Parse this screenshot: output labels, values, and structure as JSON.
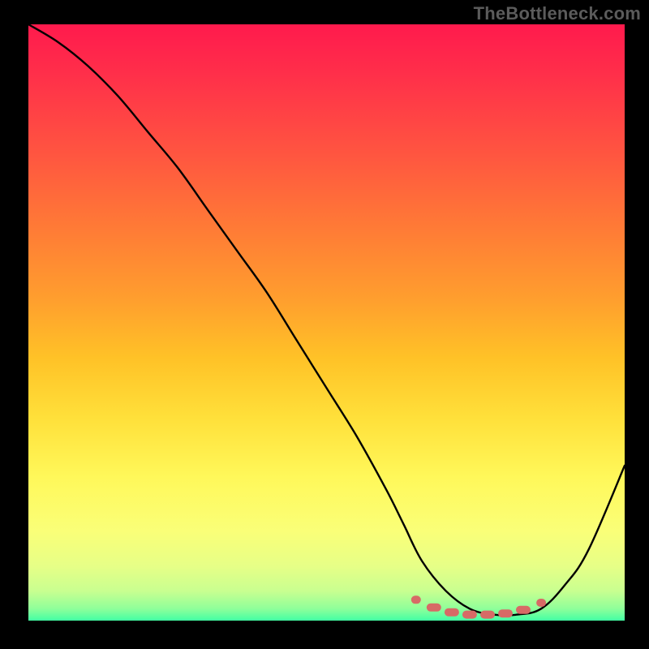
{
  "watermark": "TheBottleneck.com",
  "chart_data": {
    "type": "line",
    "title": "",
    "xlabel": "",
    "ylabel": "",
    "x_range": [
      0,
      100
    ],
    "y_range": [
      0,
      100
    ],
    "series": [
      {
        "name": "bottleneck-curve",
        "x": [
          0,
          5,
          10,
          15,
          20,
          25,
          30,
          35,
          40,
          45,
          50,
          55,
          60,
          63,
          66,
          70,
          74,
          78,
          82,
          86,
          90,
          94,
          100
        ],
        "y": [
          100,
          97,
          93,
          88,
          82,
          76,
          69,
          62,
          55,
          47,
          39,
          31,
          22,
          16,
          10,
          5,
          2,
          1,
          1,
          2,
          6,
          12,
          26
        ]
      }
    ],
    "markers": {
      "name": "optimum-band",
      "color": "#d76a66",
      "points": [
        {
          "x": 65,
          "y": 3.5
        },
        {
          "x": 68,
          "y": 2.2
        },
        {
          "x": 71,
          "y": 1.4
        },
        {
          "x": 74,
          "y": 1.0
        },
        {
          "x": 77,
          "y": 1.0
        },
        {
          "x": 80,
          "y": 1.2
        },
        {
          "x": 83,
          "y": 1.8
        },
        {
          "x": 86,
          "y": 3.0
        }
      ]
    },
    "background": {
      "type": "vertical-gradient",
      "stops": [
        {
          "pos": 0.0,
          "color": "#ff1a4d"
        },
        {
          "pos": 0.5,
          "color": "#ffb82a"
        },
        {
          "pos": 0.8,
          "color": "#fcff66"
        },
        {
          "pos": 1.0,
          "color": "#42ffa4"
        }
      ]
    }
  }
}
